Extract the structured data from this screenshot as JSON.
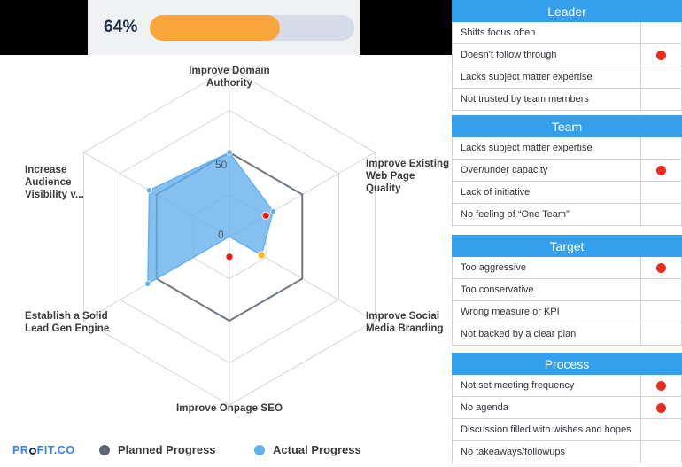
{
  "progress": {
    "percent_label": "64%",
    "percent_value": 64,
    "fill_color": "#fba63c",
    "track_color": "#d6dbe8"
  },
  "chart_data": {
    "type": "radar",
    "title": "",
    "categories": [
      "Improve Domain Authority",
      "Improve Existing Web Page Quality",
      "Improve Social Media Branding",
      "Improve Onpage SEO",
      "Establish a Solid Lead Gen Engine",
      "Increase Audience Visibility v..."
    ],
    "tick_labels": [
      "0",
      "50"
    ],
    "rmax": 100,
    "grid": true,
    "legend_position": "bottom",
    "series": [
      {
        "name": "Planned Progress",
        "color": "#5d6470",
        "values": [
          50,
          50,
          50,
          50,
          50,
          50
        ]
      },
      {
        "name": "Actual Progress",
        "color": "#62b0ed",
        "values": [
          50,
          30,
          22,
          0,
          56,
          55
        ]
      }
    ],
    "markers": [
      {
        "axis": "Improve Existing Web Page Quality",
        "color": "#e81d0e",
        "value": 25
      },
      {
        "axis": "Improve Social Media Branding",
        "color": "#f6b91e",
        "value": 22
      },
      {
        "axis": "Improve Onpage SEO",
        "color": "#e81d0e",
        "value": 12
      }
    ]
  },
  "axis_labels": {
    "top": "Improve Domain Authority",
    "right": "Improve Existing Web Page Quality",
    "bottom_right": "Improve Social Media Branding",
    "bottom": "Improve Onpage SEO",
    "bottom_left": "Establish a Solid Lead Gen Engine",
    "left": "Increase Audience Visibility v...",
    "tick_mid": "50",
    "tick_zero": "0"
  },
  "legend": {
    "logo_text_a": "PR",
    "logo_text_b": "FIT.CO",
    "items": [
      {
        "label": "Planned Progress",
        "color": "#5d6470"
      },
      {
        "label": "Actual Progress",
        "color": "#5fb3f0"
      }
    ]
  },
  "panel": {
    "header_color": "#34a0ed",
    "flag_color": "#ef2a1f",
    "tables": [
      {
        "title": "Leader",
        "rows": [
          {
            "text": "Shifts focus often",
            "flag": false
          },
          {
            "text": "Doesn't follow through",
            "flag": true
          },
          {
            "text": "Lacks subject matter expertise",
            "flag": false
          },
          {
            "text": "Not trusted by team members",
            "flag": false
          }
        ]
      },
      {
        "title": "Team",
        "rows": [
          {
            "text": "Lacks subject matter expertise",
            "flag": false
          },
          {
            "text": "Over/under capacity",
            "flag": true
          },
          {
            "text": "Lack of initiative",
            "flag": false
          },
          {
            "text": "No feeling of “One Team”",
            "flag": false
          }
        ]
      },
      {
        "title": "Target",
        "rows": [
          {
            "text": "Too aggressive",
            "flag": true
          },
          {
            "text": "Too conservative",
            "flag": false
          },
          {
            "text": "Wrong measure or KPI",
            "flag": false
          },
          {
            "text": "Not backed by a clear plan",
            "flag": false
          }
        ]
      },
      {
        "title": "Process",
        "rows": [
          {
            "text": "Not set meeting frequency",
            "flag": true
          },
          {
            "text": "No agenda",
            "flag": true
          },
          {
            "text": "Discussion filled with wishes and hopes",
            "flag": false
          },
          {
            "text": "No takeaways/followups",
            "flag": false
          }
        ]
      }
    ]
  }
}
